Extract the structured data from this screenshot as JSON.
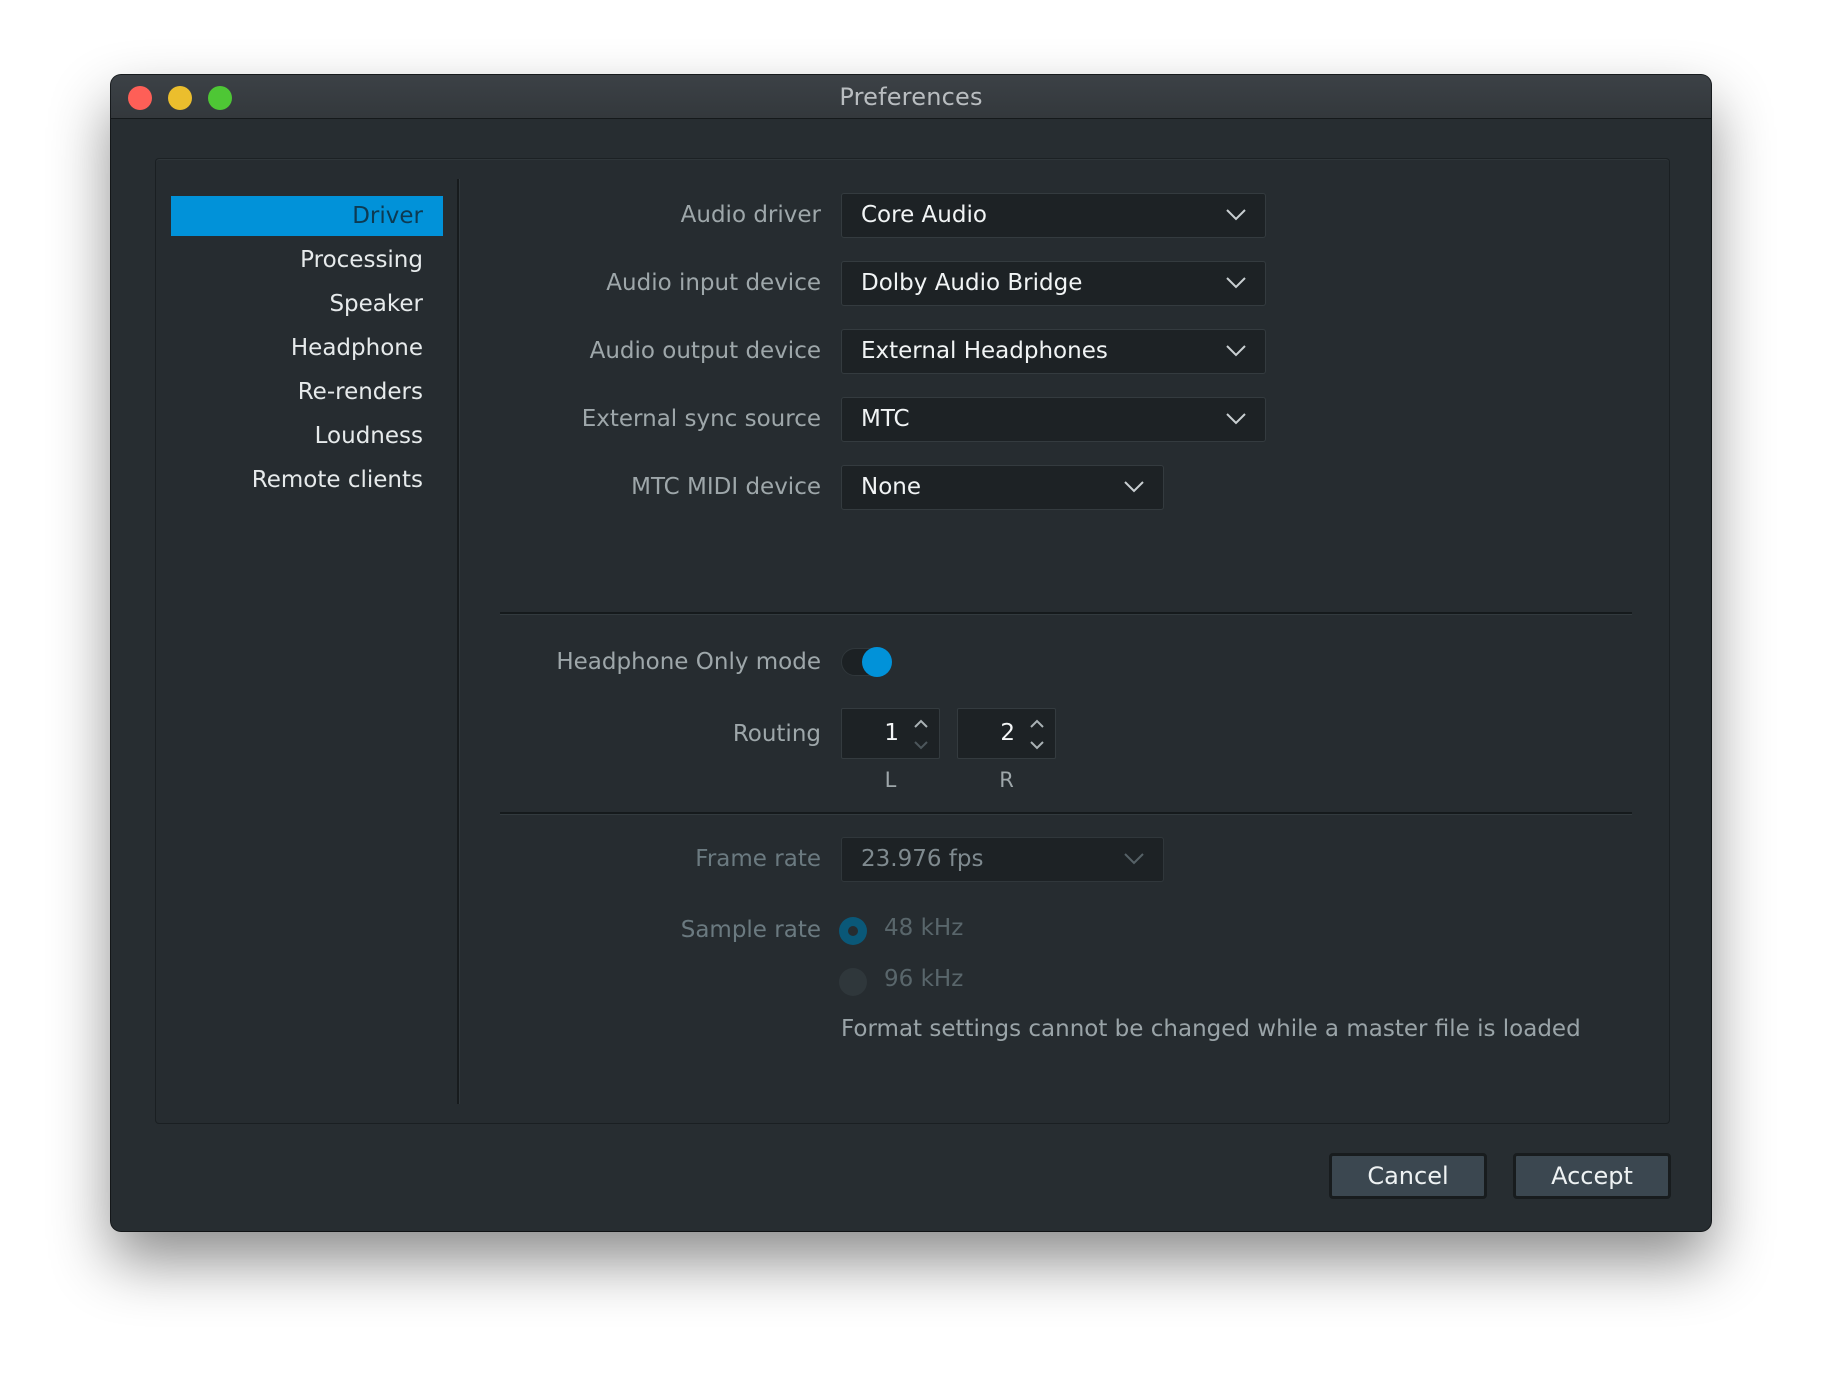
{
  "window": {
    "title": "Preferences",
    "traffic_lights": [
      "close",
      "minimize",
      "zoom"
    ]
  },
  "sidebar": {
    "items": [
      {
        "label": "Driver",
        "selected": true
      },
      {
        "label": "Processing",
        "selected": false
      },
      {
        "label": "Speaker",
        "selected": false
      },
      {
        "label": "Headphone",
        "selected": false
      },
      {
        "label": "Re-renders",
        "selected": false
      },
      {
        "label": "Loudness",
        "selected": false
      },
      {
        "label": "Remote clients",
        "selected": false
      }
    ]
  },
  "driver": {
    "audio_driver": {
      "label": "Audio driver",
      "value": "Core Audio"
    },
    "audio_input": {
      "label": "Audio input device",
      "value": "Dolby Audio Bridge"
    },
    "audio_output": {
      "label": "Audio output device",
      "value": "External Headphones"
    },
    "sync_source": {
      "label": "External sync source",
      "value": "MTC"
    },
    "mtc_midi": {
      "label": "MTC MIDI device",
      "value": "None"
    },
    "headphone_only": {
      "label": "Headphone Only mode",
      "enabled": true
    },
    "routing": {
      "label": "Routing",
      "left": {
        "value": "1",
        "caption": "L"
      },
      "right": {
        "value": "2",
        "caption": "R"
      }
    },
    "frame_rate": {
      "label": "Frame rate",
      "value": "23.976 fps",
      "disabled": true
    },
    "sample_rate": {
      "label": "Sample rate",
      "options": [
        {
          "label": "48 kHz",
          "selected": true
        },
        {
          "label": "96 kHz",
          "selected": false
        }
      ],
      "disabled": true
    },
    "format_note": "Format settings cannot be changed while a master file is loaded"
  },
  "buttons": {
    "cancel": "Cancel",
    "accept": "Accept"
  },
  "colors": {
    "accent": "#0192d9",
    "background": "#272d31"
  }
}
